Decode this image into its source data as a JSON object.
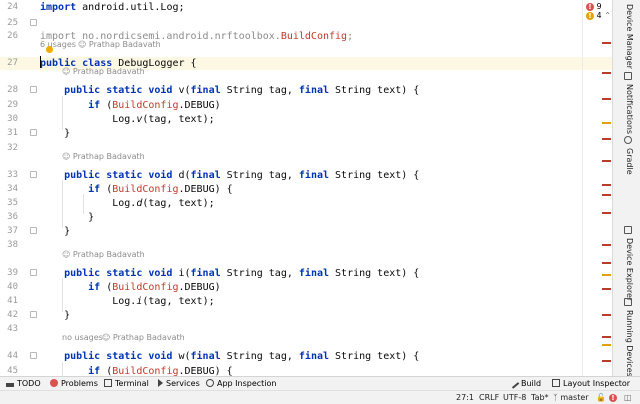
{
  "editor": {
    "lines": [
      {
        "num": "24",
        "parts": [
          [
            "kw",
            "import"
          ],
          [
            "",
            "android.util.Log;"
          ]
        ]
      },
      {
        "num": "25",
        "parts": []
      },
      {
        "num": "26",
        "parts": [
          [
            "dim",
            "import no.nordicsemi.android.nrftoolbox."
          ],
          [
            "red",
            "BuildConfig"
          ],
          [
            "dim",
            ";"
          ]
        ]
      },
      {
        "num": "27",
        "parts": [
          [
            "kw",
            "public class"
          ],
          [
            "",
            "DebugLogger {"
          ]
        ]
      },
      {
        "num": "28",
        "parts": [
          [
            "kw",
            "    public static void"
          ],
          [
            "",
            " v("
          ],
          [
            "kw",
            "final"
          ],
          [
            "",
            " String tag, "
          ],
          [
            "kw",
            "final"
          ],
          [
            "",
            " String text) {"
          ]
        ]
      },
      {
        "num": "29",
        "parts": [
          [
            "kw",
            "        if"
          ],
          [
            "",
            " ("
          ],
          [
            "red",
            "BuildConfig"
          ],
          [
            "",
            ".DEBUG)"
          ]
        ]
      },
      {
        "num": "30",
        "parts": [
          [
            "",
            "            Log."
          ],
          [
            "it",
            "v"
          ],
          [
            "",
            "(tag, text);"
          ]
        ]
      },
      {
        "num": "31",
        "parts": [
          [
            "",
            "    }"
          ]
        ]
      },
      {
        "num": "32",
        "parts": []
      },
      {
        "num": "33",
        "parts": [
          [
            "kw",
            "    public static void"
          ],
          [
            "",
            " d("
          ],
          [
            "kw",
            "final"
          ],
          [
            "",
            " String tag, "
          ],
          [
            "kw",
            "final"
          ],
          [
            "",
            " String text) {"
          ]
        ]
      },
      {
        "num": "34",
        "parts": [
          [
            "kw",
            "        if"
          ],
          [
            "",
            " ("
          ],
          [
            "red",
            "BuildConfig"
          ],
          [
            "",
            ".DEBUG) {"
          ]
        ]
      },
      {
        "num": "35",
        "parts": [
          [
            "",
            "            Log."
          ],
          [
            "it",
            "d"
          ],
          [
            "",
            "(tag, text);"
          ]
        ]
      },
      {
        "num": "36",
        "parts": [
          [
            "",
            "        }"
          ]
        ]
      },
      {
        "num": "37",
        "parts": [
          [
            "",
            "    }"
          ]
        ]
      },
      {
        "num": "38",
        "parts": []
      },
      {
        "num": "39",
        "parts": [
          [
            "kw",
            "    public static void"
          ],
          [
            "",
            " i("
          ],
          [
            "kw",
            "final"
          ],
          [
            "",
            " String tag, "
          ],
          [
            "kw",
            "final"
          ],
          [
            "",
            " String text) {"
          ]
        ]
      },
      {
        "num": "40",
        "parts": [
          [
            "kw",
            "        if"
          ],
          [
            "",
            " ("
          ],
          [
            "red",
            "BuildConfig"
          ],
          [
            "",
            ".DEBUG)"
          ]
        ]
      },
      {
        "num": "41",
        "parts": [
          [
            "",
            "            Log."
          ],
          [
            "it",
            "i"
          ],
          [
            "",
            "(tag, text);"
          ]
        ]
      },
      {
        "num": "42",
        "parts": [
          [
            "",
            "    }"
          ]
        ]
      },
      {
        "num": "43",
        "parts": []
      },
      {
        "num": "44",
        "parts": [
          [
            "kw",
            "    public static void"
          ],
          [
            "",
            " w("
          ],
          [
            "kw",
            "final"
          ],
          [
            "",
            " String tag, "
          ],
          [
            "kw",
            "final"
          ],
          [
            "",
            " String text) {"
          ]
        ]
      },
      {
        "num": "45",
        "parts": [
          [
            "kw",
            "        if"
          ],
          [
            "",
            " ("
          ],
          [
            "red",
            "BuildConfig"
          ],
          [
            "",
            ".DEBUG) {"
          ]
        ]
      }
    ],
    "hints": {
      "class_usages": "6 usages",
      "class_author": "☺ Prathap Badavath",
      "v_author": "☺ Prathap Badavath",
      "d_author": "☺ Prathap Badavath",
      "i_author": "☺ Prathap Badavath",
      "w_usages": "no usages",
      "w_author": "☺ Prathap Badavath"
    },
    "inspections": {
      "errors": "9",
      "warnings": "4"
    }
  },
  "right_toolbar": [
    "Device Manager",
    "Notifications",
    "Gradle",
    "Device Explorer",
    "Running Devices"
  ],
  "bottom_tools": {
    "todo": "TODO",
    "problems": "Problems",
    "terminal": "Terminal",
    "services": "Services",
    "app_inspection": "App Inspection",
    "build": "Build",
    "layout_inspector": "Layout Inspector"
  },
  "status": {
    "position": "27:1",
    "line_sep": "CRLF",
    "encoding": "UTF-8",
    "indent": "Tab*",
    "branch": "master"
  },
  "colors": {
    "keyword": "#0033b3",
    "error": "#c0392b",
    "warning": "#e5a100",
    "current_line": "#fcf8e3"
  }
}
